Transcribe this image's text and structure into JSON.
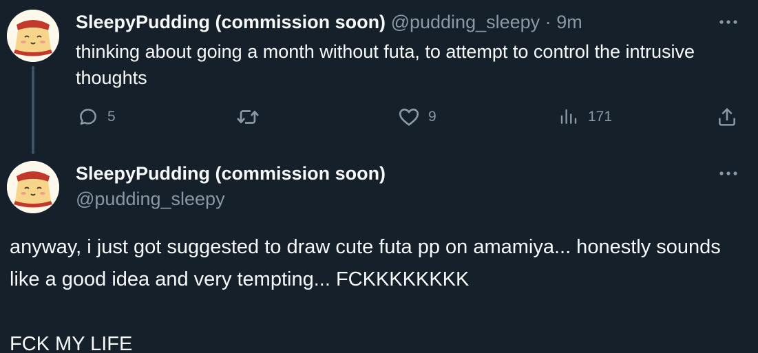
{
  "tweet1": {
    "display_name": "SleepyPudding (commission soon)",
    "handle": "@pudding_sleepy",
    "separator": "·",
    "time": "9m",
    "text": "thinking about going a month without futa, to attempt to control the intrusive thoughts",
    "actions": {
      "reply_count": "5",
      "retweet_count": "",
      "like_count": "9",
      "view_count": "171"
    }
  },
  "tweet2": {
    "display_name": "SleepyPudding (commission soon)",
    "handle": "@pudding_sleepy",
    "text_paragraph_1": "anyway, i just got suggested to draw cute futa pp on amamiya... honestly sounds like a good idea and very tempting... FCKKKKKKKK",
    "text_paragraph_2": "FCK MY LIFE"
  },
  "icons": {
    "more": "more-dots-icon",
    "reply": "reply-bubble-icon",
    "retweet": "retweet-icon",
    "like": "heart-icon",
    "views": "views-bar-chart-icon",
    "share": "share-upload-icon"
  },
  "colors": {
    "background": "#15202b",
    "text_primary": "#f7f9f9",
    "text_muted": "#8b98a5",
    "thread_line": "#425364"
  }
}
